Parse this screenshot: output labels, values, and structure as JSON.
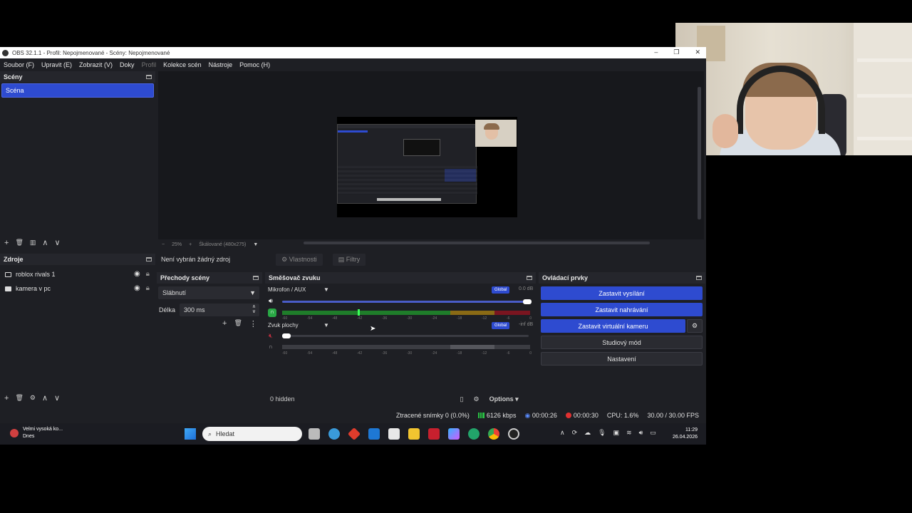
{
  "window": {
    "title": "OBS 32.1.1 - Profil: Nepojmenované - Scény: Nepojmenované",
    "controls": [
      "–",
      "❐",
      "✕"
    ]
  },
  "menu": [
    "Soubor (F)",
    "Upravit (E)",
    "Zobrazit (V)",
    "Doky",
    "Profil",
    "Kolekce scén",
    "Nástroje",
    "Pomoc (H)"
  ],
  "scenes": {
    "title": "Scény",
    "items": [
      "Scéna"
    ],
    "toolbar": [
      "+",
      "🗑",
      "▥",
      "∧",
      "∨"
    ]
  },
  "preview": {
    "zoom_minus": "−",
    "zoom_level": "25%",
    "zoom_plus": "+",
    "scale_mode": "Škálované (480x275)"
  },
  "context": {
    "no_source": "Není vybrán žádný zdroj",
    "properties": "Vlastnosti",
    "filters": "Filtry"
  },
  "sources": {
    "title": "Zdroje",
    "items": [
      {
        "name": "roblox rivals 1",
        "icon": "monitor-icon"
      },
      {
        "name": "kamera v pc",
        "icon": "camera-icon"
      }
    ],
    "toolbar": [
      "+",
      "🗑",
      "⚙",
      "∧",
      "∨"
    ]
  },
  "transitions": {
    "title": "Přechody scény",
    "selected": "Slábnutí",
    "duration_label": "Délka",
    "duration_value": "300 ms"
  },
  "mixer": {
    "title": "Směšovač zvuku",
    "tracks": [
      {
        "name": "Mikrofon / AUX",
        "badge": "Global",
        "db": "0.0 dB",
        "level": 0.9
      },
      {
        "name": "Zvuk plochy",
        "badge": "Global",
        "db": "-inf dB",
        "level": 0.0
      }
    ],
    "ticks": [
      "-60",
      "-54",
      "-48",
      "-42",
      "-36",
      "-30",
      "-24",
      "-18",
      "-12",
      "-6",
      "0"
    ],
    "hidden": "0 hidden",
    "options": "Options"
  },
  "controls": {
    "title": "Ovládací prvky",
    "stop_stream": "Zastavit vysílání",
    "stop_record": "Zastavit nahrávání",
    "stop_vcam": "Zastavit virtuální kameru",
    "studio_mode": "Studiový mód",
    "settings": "Nastavení"
  },
  "status": {
    "dropped": "Ztracené snímky 0 (0.0%)",
    "bitrate": "6126 kbps",
    "stream_time": "00:00:26",
    "rec_time": "00:00:30",
    "cpu": "CPU: 1.6%",
    "fps": "30.00 / 30.00 FPS"
  },
  "taskbar": {
    "weather_title": "Velmi vysoká ko...",
    "weather_sub": "Dnes",
    "search_placeholder": "Hledat",
    "time": "11:29",
    "date": "26.04.2026"
  },
  "colors": {
    "accent": "#2e4bd0",
    "panel": "#1e1f24",
    "recording": "#e03030"
  }
}
